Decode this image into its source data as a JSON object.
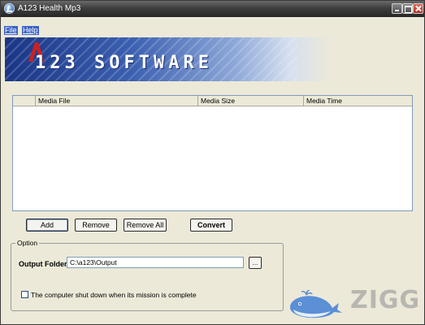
{
  "window": {
    "title": "A123 Health Mp3"
  },
  "menu": {
    "items": [
      {
        "label": "File"
      },
      {
        "label": "Help"
      }
    ]
  },
  "banner": {
    "logo_text": "123 SOFTWARE"
  },
  "media_list": {
    "columns": [
      {
        "label": ""
      },
      {
        "label": "Media File"
      },
      {
        "label": "Media Size"
      },
      {
        "label": "Media Time"
      }
    ],
    "rows": []
  },
  "buttons": {
    "add": "Add",
    "remove": "Remove",
    "remove_all": "Remove All",
    "convert": "Convert"
  },
  "option": {
    "legend": "Option",
    "output_folder_label": "Output Folder:",
    "output_folder_value": "C:\\a123\\Output",
    "browse_label": "...",
    "shutdown_label": "The computer shut down when its mission is complete",
    "shutdown_checked": false
  },
  "watermark": {
    "text": "ZIGG"
  },
  "colors": {
    "face": "#ece9d8",
    "banner_blue": "#1a3585",
    "logo_red": "#cc2020",
    "menu_highlight": "#3b63c4"
  }
}
